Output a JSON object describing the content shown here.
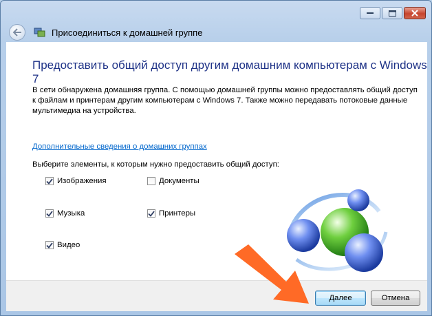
{
  "window": {
    "title": "Присоединиться к домашней группе"
  },
  "content": {
    "heading": "Предоставить общий доступ другим домашним компьютерам с Windows 7",
    "paragraph": "В сети обнаружена домашняя группа. С помощью домашней группы можно предоставлять общий доступ к файлам и принтерам другим компьютерам с Windows 7. Также можно передавать потоковые данные мультимедиа на устройства.",
    "link": "Дополнительные сведения о домашних группах",
    "prompt": "Выберите элементы, к которым нужно предоставить общий доступ:",
    "items": [
      {
        "label": "Изображения",
        "checked": true
      },
      {
        "label": "Документы",
        "checked": false
      },
      {
        "label": "Музыка",
        "checked": true
      },
      {
        "label": "Принтеры",
        "checked": true
      },
      {
        "label": "Видео",
        "checked": true
      }
    ]
  },
  "footer": {
    "next_label": "Далее",
    "cancel_label": "Отмена"
  },
  "colors": {
    "heading": "#1e3287",
    "link": "#0066cc",
    "arrow": "#ff6a26"
  },
  "icons": [
    "back-arrow-icon",
    "homegroup-icon",
    "minimize-icon",
    "maximize-icon",
    "close-icon",
    "checkmark-icon",
    "homegroup-logo",
    "pointer-arrow"
  ]
}
